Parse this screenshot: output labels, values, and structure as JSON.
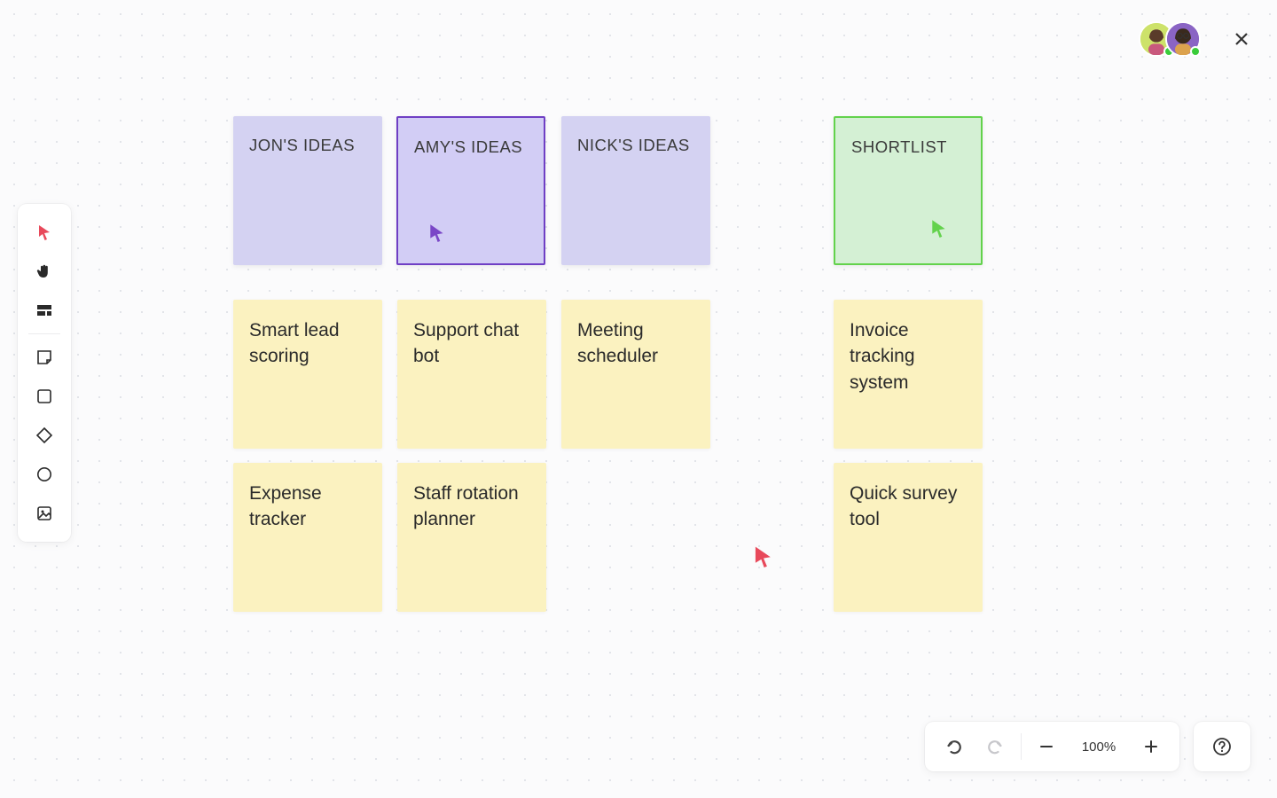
{
  "toolbar": {
    "pointer": "pointer",
    "hand": "hand",
    "section": "section",
    "sticky": "sticky-note",
    "rect": "rectangle",
    "diamond": "diamond",
    "circle": "circle",
    "image": "image"
  },
  "headers": {
    "jon": "JON'S IDEAS",
    "amy": "AMY'S IDEAS",
    "nick": "NICK'S IDEAS",
    "shortlist": "SHORTLIST"
  },
  "ideas": {
    "a1": "Smart lead scoring",
    "a2": "Expense tracker",
    "b1": "Support chat bot",
    "b2": "Staff rotation planner",
    "c1": "Meeting scheduler",
    "s1": "Invoice tracking system",
    "s2": "Quick survey tool"
  },
  "zoom": {
    "value": "100%"
  },
  "colors": {
    "cursor_red": "#e8495b",
    "cursor_purple": "#7a47c7",
    "cursor_green": "#63d24c"
  }
}
